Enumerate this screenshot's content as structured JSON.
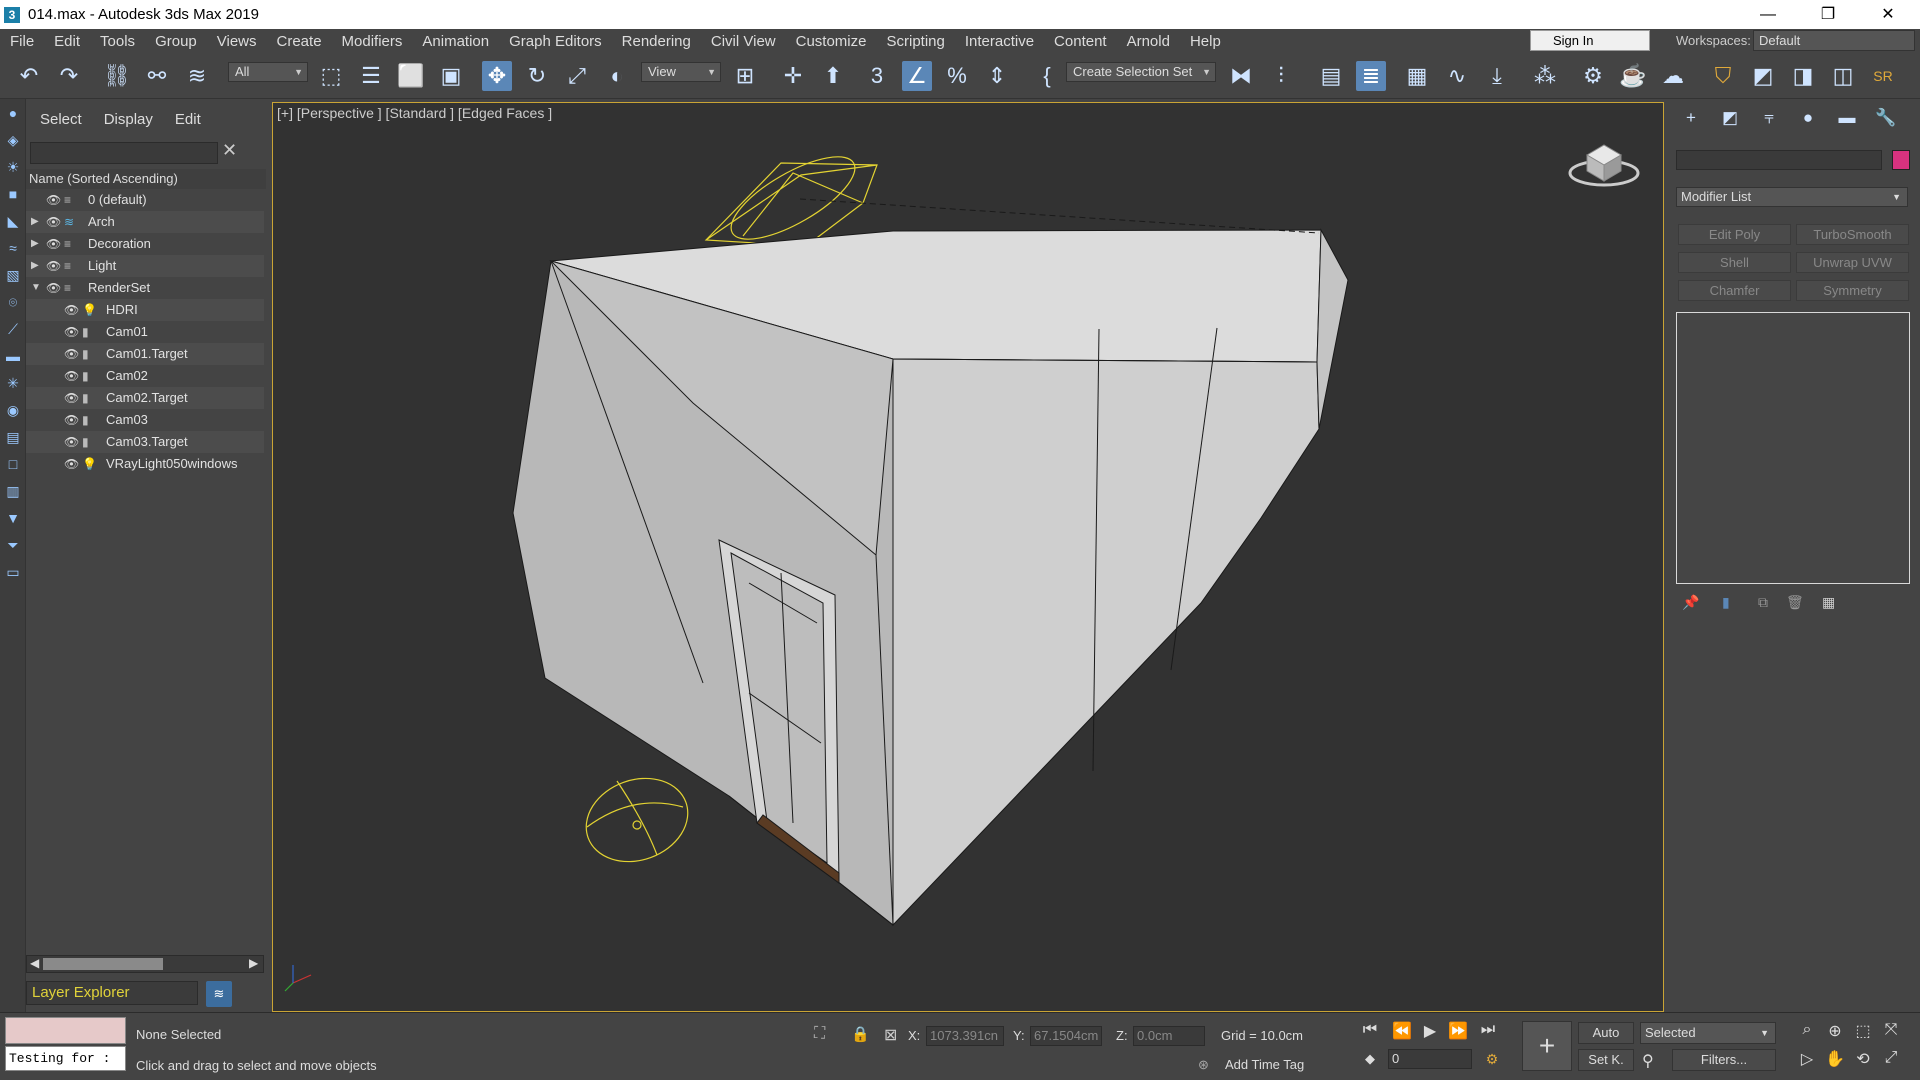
{
  "titlebar": {
    "app_icon": "3",
    "title": "014.max - Autodesk 3ds Max 2019",
    "minimize": "—",
    "restore": "❐",
    "close": "✕"
  },
  "menubar": {
    "items": [
      "File",
      "Edit",
      "Tools",
      "Group",
      "Views",
      "Create",
      "Modifiers",
      "Animation",
      "Graph Editors",
      "Rendering",
      "Civil View",
      "Customize",
      "Scripting",
      "Interactive",
      "Content",
      "Arnold",
      "Help"
    ],
    "sign_in": "Sign In",
    "workspaces_label": "Workspaces:",
    "workspace_value": "Default"
  },
  "toolbar": {
    "filter_value": "All",
    "refcoord_value": "View",
    "selection_set_value": "Create Selection Set",
    "sr_label": "SR"
  },
  "scene_explorer": {
    "tabs": [
      "Select",
      "Display",
      "Edit"
    ],
    "column_header": "Name (Sorted Ascending)",
    "rows": [
      {
        "label": "0 (default)",
        "level": 0,
        "expander": "",
        "icon": "layer"
      },
      {
        "label": "Arch",
        "level": 0,
        "expander": "▶",
        "icon": "layer-active"
      },
      {
        "label": "Decoration",
        "level": 0,
        "expander": "▶",
        "icon": "layer"
      },
      {
        "label": "Light",
        "level": 0,
        "expander": "▶",
        "icon": "layer"
      },
      {
        "label": "RenderSet",
        "level": 0,
        "expander": "▼",
        "icon": "layer"
      },
      {
        "label": "HDRI",
        "level": 1,
        "expander": "",
        "icon": "light"
      },
      {
        "label": "Cam01",
        "level": 1,
        "expander": "",
        "icon": "camera"
      },
      {
        "label": "Cam01.Target",
        "level": 1,
        "expander": "",
        "icon": "camera"
      },
      {
        "label": "Cam02",
        "level": 1,
        "expander": "",
        "icon": "camera"
      },
      {
        "label": "Cam02.Target",
        "level": 1,
        "expander": "",
        "icon": "camera"
      },
      {
        "label": "Cam03",
        "level": 1,
        "expander": "",
        "icon": "camera"
      },
      {
        "label": "Cam03.Target",
        "level": 1,
        "expander": "",
        "icon": "camera"
      },
      {
        "label": "VRayLight050windows",
        "level": 1,
        "expander": "",
        "icon": "light"
      }
    ],
    "explorer_dropdown": "Layer Explorer"
  },
  "viewport": {
    "label": "[+] [Perspective ] [Standard ] [Edged Faces ]"
  },
  "command_panel": {
    "modifier_list": "Modifier List",
    "modifier_buttons": [
      "Edit Poly",
      "TurboSmooth",
      "Shell",
      "Unwrap UVW",
      "Chamfer",
      "Symmetry"
    ],
    "object_color": "#d8327f"
  },
  "status": {
    "maxscript_input": "Testing for :",
    "selection_status": "None Selected",
    "prompt": "Click and drag to select and move objects",
    "x_label": "X:",
    "x_value": "1073.391cn",
    "y_label": "Y:",
    "y_value": "67.1504cm",
    "z_label": "Z:",
    "z_value": "0.0cm",
    "grid": "Grid = 10.0cm",
    "add_time_tag": "Add Time Tag",
    "auto_key": "Auto",
    "set_key": "Set K.",
    "key_filter_value": "Selected",
    "filters": "Filters...",
    "frame_value": "0"
  },
  "colors": {
    "accent": "#5b87b7",
    "viewport_border": "#c9a435",
    "helper_yellow": "#e3d332"
  }
}
